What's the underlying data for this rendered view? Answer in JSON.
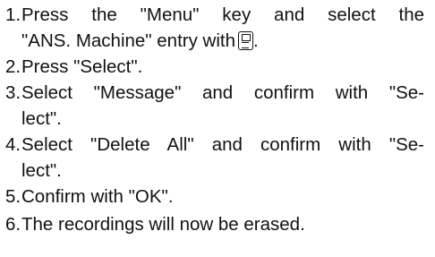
{
  "steps": [
    {
      "number": "1.",
      "lines": [
        "Press the \"Menu\" key and select the",
        "\"ANS. Machine\" entry with",
        "."
      ],
      "icon": "phone-handset-icon"
    },
    {
      "number": "2.",
      "lines": [
        "Press \"Select\"."
      ]
    },
    {
      "number": "3.",
      "lines": [
        "Select \"Message\" and confirm with \"Se-",
        "lect\"."
      ]
    },
    {
      "number": "4.",
      "lines": [
        "Select \"Delete All\" and confirm with \"Se-",
        "lect\"."
      ]
    },
    {
      "number": "5.",
      "lines": [
        "Confirm with \"OK\"."
      ]
    },
    {
      "number": "6.",
      "lines": [
        "The recordings will now be erased."
      ]
    }
  ]
}
